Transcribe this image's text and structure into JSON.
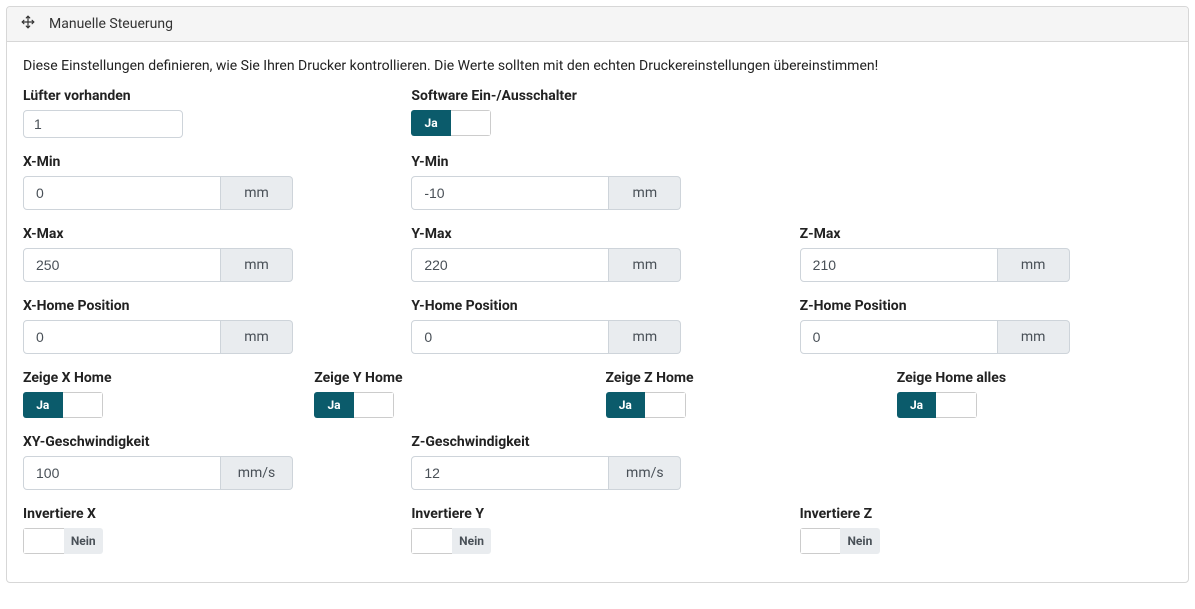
{
  "panel": {
    "title": "Manuelle Steuerung",
    "description": "Diese Einstellungen definieren, wie Sie Ihren Drucker kontrollieren. Die Werte sollten mit den echten Druckereinstellungen übereinstimmen!"
  },
  "labels": {
    "fanAvailable": "Lüfter vorhanden",
    "softwareSwitch": "Software Ein-/Ausschalter",
    "xMin": "X-Min",
    "yMin": "Y-Min",
    "xMax": "X-Max",
    "yMax": "Y-Max",
    "zMax": "Z-Max",
    "xHomePos": "X-Home Position",
    "yHomePos": "Y-Home Position",
    "zHomePos": "Z-Home Position",
    "showXHome": "Zeige X Home",
    "showYHome": "Zeige Y Home",
    "showZHome": "Zeige Z Home",
    "showHomeAll": "Zeige Home alles",
    "xySpeed": "XY-Geschwindigkeit",
    "zSpeed": "Z-Geschwindigkeit",
    "invertX": "Invertiere X",
    "invertY": "Invertiere Y",
    "invertZ": "Invertiere Z"
  },
  "values": {
    "fanAvailable": "1",
    "xMin": "0",
    "yMin": "-10",
    "xMax": "250",
    "yMax": "220",
    "zMax": "210",
    "xHomePos": "0",
    "yHomePos": "0",
    "zHomePos": "0",
    "xySpeed": "100",
    "zSpeed": "12"
  },
  "units": {
    "mm": "mm",
    "mms": "mm/s"
  },
  "toggle": {
    "yes": "Ja",
    "no": "Nein"
  }
}
